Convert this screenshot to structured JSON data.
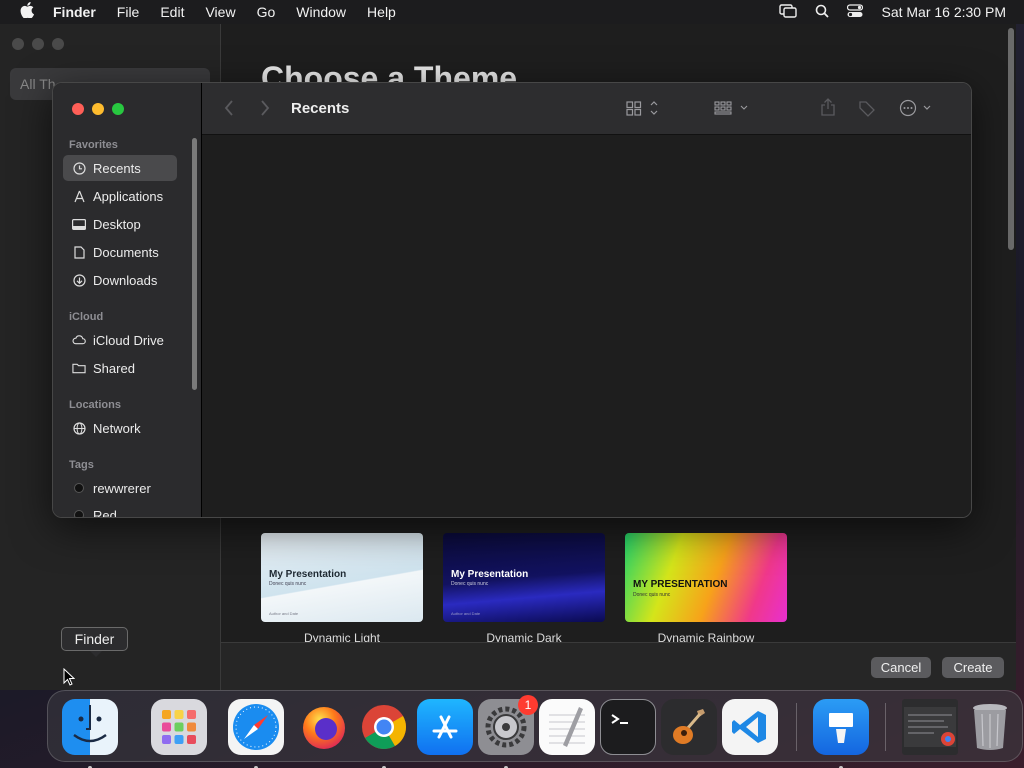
{
  "menubar": {
    "app_name": "Finder",
    "items": [
      "File",
      "Edit",
      "View",
      "Go",
      "Window",
      "Help"
    ],
    "datetime": "Sat Mar 16  2:30 PM"
  },
  "background_window": {
    "sidebar_search": "All Th",
    "title": "Choose a Theme",
    "themes": [
      {
        "name": "Dynamic Light",
        "slide_title": "My Presentation",
        "slide_subtitle": "Donec quis nunc",
        "slide_footer": "Author and Date"
      },
      {
        "name": "Dynamic Dark",
        "slide_title": "My Presentation",
        "slide_subtitle": "Donec quis nunc",
        "slide_footer": "Author and Date"
      },
      {
        "name": "Dynamic Rainbow",
        "slide_title": "MY PRESENTATION",
        "slide_subtitle": "Donec quis nunc",
        "slide_footer": ""
      }
    ],
    "cancel_label": "Cancel",
    "create_label": "Create"
  },
  "finder": {
    "title": "Recents",
    "sections": {
      "favorites": "Favorites",
      "icloud": "iCloud",
      "locations": "Locations",
      "tags": "Tags"
    },
    "favorites": [
      {
        "label": "Recents",
        "icon": "clock-icon",
        "selected": true
      },
      {
        "label": "Applications",
        "icon": "applications-icon"
      },
      {
        "label": "Desktop",
        "icon": "desktop-icon"
      },
      {
        "label": "Documents",
        "icon": "document-icon"
      },
      {
        "label": "Downloads",
        "icon": "download-icon"
      }
    ],
    "icloud": [
      {
        "label": "iCloud Drive",
        "icon": "cloud-icon"
      },
      {
        "label": "Shared",
        "icon": "shared-folder-icon"
      }
    ],
    "locations": [
      {
        "label": "Network",
        "icon": "globe-icon"
      }
    ],
    "tags": [
      {
        "label": "rewwrerer",
        "color": "#111111"
      },
      {
        "label": "Red",
        "color": "#111111"
      }
    ]
  },
  "tooltip": "Finder",
  "dock": {
    "apps": [
      "Finder",
      "Launchpad",
      "Safari",
      "Firefox",
      "Chrome",
      "App Store",
      "System Settings",
      "TextEdit",
      "Terminal",
      "GarageBand",
      "VS Code",
      "Keynote",
      "Chrome Window",
      "Trash"
    ],
    "settings_badge": "1"
  },
  "colors": {
    "traffic_red": "#ff5f57",
    "traffic_yellow": "#febc2e",
    "traffic_green": "#28c840",
    "button_gray": "#5b5b5e"
  }
}
